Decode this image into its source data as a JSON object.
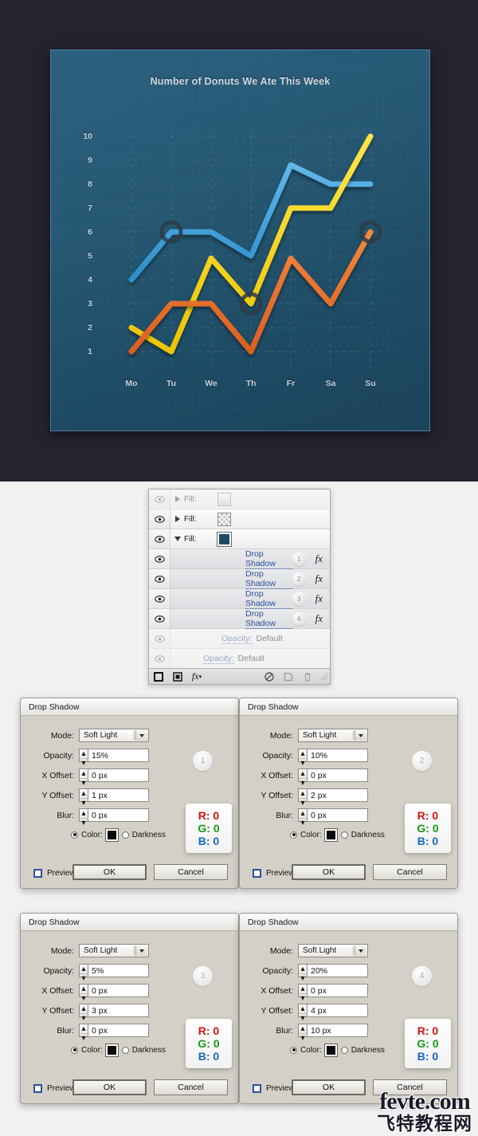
{
  "chart_data": {
    "type": "line",
    "title": "Number of Donuts We Ate This Week",
    "xlabel": "",
    "ylabel": "",
    "categories": [
      "Mo",
      "Tu",
      "We",
      "Th",
      "Fr",
      "Sa",
      "Su"
    ],
    "ytick_labels": [
      "10",
      "9",
      "8",
      "7",
      "6",
      "5",
      "4",
      "3",
      "2",
      "1"
    ],
    "ylim": [
      0,
      10
    ],
    "grid": true,
    "legend_position": "none",
    "series": [
      {
        "name": "blue",
        "color": "#3ba0dc",
        "values": [
          4,
          6,
          6,
          5,
          8.8,
          8,
          8
        ]
      },
      {
        "name": "yellow",
        "color": "#fad81e",
        "values": [
          2,
          1,
          4.9,
          3,
          7,
          7,
          10
        ]
      },
      {
        "name": "orange",
        "color": "#e8702a",
        "values": [
          1,
          3,
          3,
          1,
          4.9,
          3,
          6
        ]
      }
    ],
    "markers": [
      {
        "series": "blue",
        "category": "Tu",
        "value": 6
      },
      {
        "series": "yellow",
        "category": "Th",
        "value": 3
      },
      {
        "series": "orange",
        "category": "Su",
        "value": 6
      }
    ]
  },
  "layers_panel": {
    "rows": [
      {
        "type": "fill",
        "label": "Fill:",
        "thumb": "gradient-thumbnail",
        "expanded": false,
        "visible": false,
        "dim": true
      },
      {
        "type": "fill",
        "label": "Fill:",
        "thumb": "checker-thumbnail",
        "expanded": false,
        "visible": true,
        "dim": false
      },
      {
        "type": "fill",
        "label": "Fill:",
        "thumb": "navy-thumbnail",
        "expanded": true,
        "visible": true,
        "dim": false
      },
      {
        "type": "effect",
        "label": "Drop Shadow",
        "badge": "1",
        "fx": "fx",
        "visible": true,
        "dim": false
      },
      {
        "type": "effect",
        "label": "Drop Shadow",
        "badge": "2",
        "fx": "fx",
        "visible": true,
        "dim": false
      },
      {
        "type": "effect",
        "label": "Drop Shadow",
        "badge": "3",
        "fx": "fx",
        "visible": true,
        "dim": false
      },
      {
        "type": "effect",
        "label": "Drop Shadow",
        "badge": "4",
        "fx": "fx",
        "visible": true,
        "dim": false
      },
      {
        "type": "opacity",
        "label": "Opacity:",
        "value": "Default",
        "visible": false,
        "dim": true
      },
      {
        "type": "opacity",
        "label": "Opacity:",
        "value": "Default",
        "visible": false,
        "dim": true
      }
    ],
    "toolbar": {
      "icons": [
        "square-outline-icon",
        "square-filled-icon",
        "fx-menu-icon",
        "no-entry-icon",
        "new-layer-icon",
        "trash-icon",
        "resize-grip-icon"
      ]
    }
  },
  "dialogs": [
    {
      "title": "Drop Shadow",
      "badge": "1",
      "mode_label": "Mode:",
      "mode_value": "Soft Light",
      "opacity_label": "Opacity:",
      "opacity_value": "15%",
      "xoffset_label": "X Offset:",
      "xoffset_value": "0 px",
      "yoffset_label": "Y Offset:",
      "yoffset_value": "1 px",
      "blur_label": "Blur:",
      "blur_value": "0 px",
      "color_label": "Color:",
      "color_value": "#0a0a0a",
      "darkness_label": "Darkness",
      "preview_label": "Preview",
      "ok_label": "OK",
      "cancel_label": "Cancel",
      "rgb": {
        "r": "R: 0",
        "g": "G: 0",
        "b": "B: 0"
      }
    },
    {
      "title": "Drop Shadow",
      "badge": "2",
      "mode_label": "Mode:",
      "mode_value": "Soft Light",
      "opacity_label": "Opacity:",
      "opacity_value": "10%",
      "xoffset_label": "X Offset:",
      "xoffset_value": "0 px",
      "yoffset_label": "Y Offset:",
      "yoffset_value": "2 px",
      "blur_label": "Blur:",
      "blur_value": "0 px",
      "color_label": "Color:",
      "color_value": "#0a0a0a",
      "darkness_label": "Darkness",
      "preview_label": "Preview",
      "ok_label": "OK",
      "cancel_label": "Cancel",
      "rgb": {
        "r": "R: 0",
        "g": "G: 0",
        "b": "B: 0"
      }
    },
    {
      "title": "Drop Shadow",
      "badge": "3",
      "mode_label": "Mode:",
      "mode_value": "Soft Light",
      "opacity_label": "Opacity:",
      "opacity_value": "5%",
      "xoffset_label": "X Offset:",
      "xoffset_value": "0 px",
      "yoffset_label": "Y Offset:",
      "yoffset_value": "3 px",
      "blur_label": "Blur:",
      "blur_value": "0 px",
      "color_label": "Color:",
      "color_value": "#0a0a0a",
      "darkness_label": "Darkness",
      "preview_label": "Preview",
      "ok_label": "OK",
      "cancel_label": "Cancel",
      "rgb": {
        "r": "R: 0",
        "g": "G: 0",
        "b": "B: 0"
      }
    },
    {
      "title": "Drop Shadow",
      "badge": "4",
      "mode_label": "Mode:",
      "mode_value": "Soft Light",
      "opacity_label": "Opacity:",
      "opacity_value": "20%",
      "xoffset_label": "X Offset:",
      "xoffset_value": "0 px",
      "yoffset_label": "Y Offset:",
      "yoffset_value": "4 px",
      "blur_label": "Blur:",
      "blur_value": "10 px",
      "color_label": "Color:",
      "color_value": "#0a0a0a",
      "darkness_label": "Darkness",
      "preview_label": "Preview",
      "ok_label": "OK",
      "cancel_label": "Cancel",
      "rgb": {
        "r": "R: 0",
        "g": "G: 0",
        "b": "B: 0"
      }
    }
  ],
  "watermark": {
    "line1": "fevte.com",
    "line2": "飞特教程网"
  },
  "colors": {
    "page_dark": "#272230",
    "page_light": "#f1f1f2",
    "chart_bg_top": "#2a5f7d",
    "chart_bg_bottom": "#1a4259",
    "series_blue": "#3ba0dc",
    "series_yellow": "#fad81e",
    "series_orange": "#e8702a",
    "dialog_bg": "#d4d0c8"
  }
}
